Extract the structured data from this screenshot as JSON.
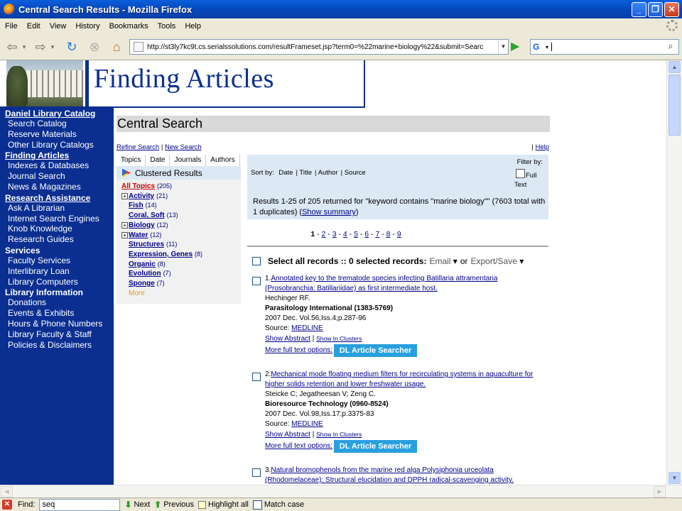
{
  "window": {
    "title": "Central Search Results - Mozilla Firefox"
  },
  "menubar": {
    "items": [
      "File",
      "Edit",
      "View",
      "History",
      "Bookmarks",
      "Tools",
      "Help"
    ]
  },
  "navbar": {
    "url": "http://st3ly7kc9t.cs.serialssolutions.com/resultFrameset.jsp?term0=%22marine+biology%22&submit=Searc",
    "search_engine_icon": "G",
    "search_value": ""
  },
  "header": {
    "title": "Finding Articles"
  },
  "sidebar": {
    "sections": [
      {
        "heading": "Daniel Library Catalog",
        "underline": true,
        "links": [
          "Search Catalog",
          "Reserve Materials",
          "Other Library Catalogs"
        ]
      },
      {
        "heading": "Finding Articles",
        "underline": true,
        "links": [
          "Indexes & Databases",
          "Journal Search",
          "News & Magazines"
        ]
      },
      {
        "heading": "Research Assistance",
        "underline": true,
        "links": [
          "Ask A Librarian",
          "Internet Search Engines",
          "Knob Knowledge",
          "Research Guides"
        ]
      },
      {
        "heading": "Services",
        "underline": false,
        "links": [
          "Faculty Services",
          "Interlibrary Loan",
          "Library Computers"
        ]
      },
      {
        "heading": "Library Information",
        "underline": false,
        "links": [
          "Donations",
          "Events & Exhibits",
          "Hours & Phone Numbers",
          "Library Faculty & Staff",
          "Policies & Disclaimers"
        ]
      }
    ]
  },
  "main": {
    "section_title": "Central Search",
    "refine_search": "Refine Search",
    "new_search": "New Search",
    "help": "Help",
    "tabs": [
      "Topics",
      "Date",
      "Journals",
      "Authors"
    ],
    "clustered_results": "Clustered Results",
    "topics": [
      {
        "name": "All Topics",
        "count": "(205)",
        "expand": ""
      },
      {
        "name": "Activity",
        "count": "(21)",
        "expand": "+"
      },
      {
        "name": "Fish",
        "count": "(14)",
        "expand": ""
      },
      {
        "name": "Coral, Soft",
        "count": "(13)",
        "expand": ""
      },
      {
        "name": "Biology",
        "count": "(12)",
        "expand": "+"
      },
      {
        "name": "Water",
        "count": "(12)",
        "expand": "+"
      },
      {
        "name": "Structures",
        "count": "(11)",
        "expand": ""
      },
      {
        "name": "Expression, Genes",
        "count": "(8)",
        "expand": ""
      },
      {
        "name": "Organic",
        "count": "(8)",
        "expand": ""
      },
      {
        "name": "Evolution",
        "count": "(7)",
        "expand": ""
      },
      {
        "name": "Sponge",
        "count": "(7)",
        "expand": ""
      }
    ],
    "more_label": "More",
    "sort_by_label": "Sort by:",
    "sort_options": [
      "Date",
      "Title",
      "Author",
      "Source"
    ],
    "filter_by": "Filter by:",
    "full_text": "Full",
    "full_text_2": "Text",
    "summary_prefix": "Results 1-25 of 205 returned for \"keyword contains \"marine biology\"\" (7603 total with 1 duplicates) (",
    "show_summary": "Show summary",
    "summary_suffix": ")",
    "pages": [
      "1",
      "2",
      "3",
      "4",
      "5",
      "6",
      "7",
      "8",
      "9"
    ],
    "select_all": "Select all records :: 0 selected records:",
    "email": "Email",
    "or": "or",
    "export_save": "Export/Save"
  },
  "records": [
    {
      "num": "1.",
      "title": "Annotated key to the trematode species infecting Batillaria attramentaria (Prosobranchia: Batillariidae) as first intermediate host.",
      "authors": "Hechinger RF.",
      "journal": "Parasitology International (1383-5769)",
      "details": "2007 Dec. Vol.56,Iss.4;p.287-96",
      "source_label": "Source:",
      "source": "MEDLINE",
      "show_abstract": "Show Abstract",
      "show_in_clusters": "Show In Clusters",
      "more_options": "More full text options:",
      "dl_button": "DL Article Searcher"
    },
    {
      "num": "2.",
      "title": "Mechanical mode floating medium filters for recirculating systems in aquaculture for higher solids retention and lower freshwater usage.",
      "authors": "Steicke C; Jegatheesan V; Zeng C.",
      "journal": "Bioresource Technology (0960-8524)",
      "details": "2007 Dec. Vol.98,Iss.17;p.3375-83",
      "source_label": "Source:",
      "source": "MEDLINE",
      "show_abstract": "Show Abstract",
      "show_in_clusters": "Show In Clusters",
      "more_options": "More full text options:",
      "dl_button": "DL Article Searcher"
    },
    {
      "num": "3.",
      "title": "Natural bromophenols from the marine red alga Polysiphonia urceolata (Rhodomelaceae): Structural elucidation and DPPH radical-scavenging activity.",
      "authors": "",
      "journal": "",
      "details": "",
      "source_label": "",
      "source": "",
      "show_abstract": "",
      "show_in_clusters": "",
      "more_options": "",
      "dl_button": ""
    }
  ],
  "findbar": {
    "label": "Find:",
    "value": "seq",
    "next": "Next",
    "previous": "Previous",
    "highlight_all": "Highlight all",
    "match_case": "Match case"
  },
  "colors": {
    "sidebar": "#0b2f91",
    "title_blue": "#0b2f91",
    "dl_button": "#28a0e0",
    "sortbox": "#dce8f4"
  }
}
